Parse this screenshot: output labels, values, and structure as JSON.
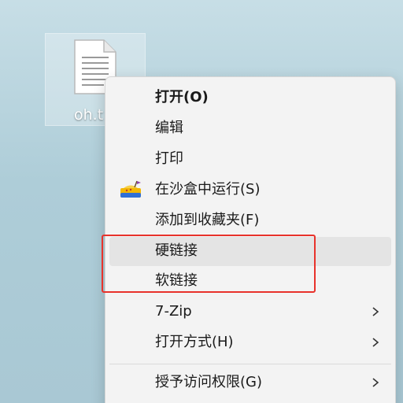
{
  "desktop": {
    "file_label": "oh.t",
    "file_icon": "text-document-icon"
  },
  "context_menu": {
    "items": [
      {
        "label": "打开(O)",
        "bold": true
      },
      {
        "label": "编辑"
      },
      {
        "label": "打印"
      },
      {
        "label": "在沙盒中运行(S)",
        "icon": "sandbox-icon"
      },
      {
        "label": "添加到收藏夹(F)"
      },
      {
        "label": "硬链接",
        "highlighted": true
      },
      {
        "label": "软链接",
        "highlighted": true
      },
      {
        "label": "7-Zip",
        "submenu": true
      },
      {
        "label": "打开方式(H)",
        "submenu": true
      },
      {
        "label": "授予访问权限(G)",
        "submenu": true
      }
    ]
  },
  "colors": {
    "annotation_border": "#e8322b",
    "menu_background": "#f3f3f3",
    "hover_background": "#e4e4e4"
  }
}
